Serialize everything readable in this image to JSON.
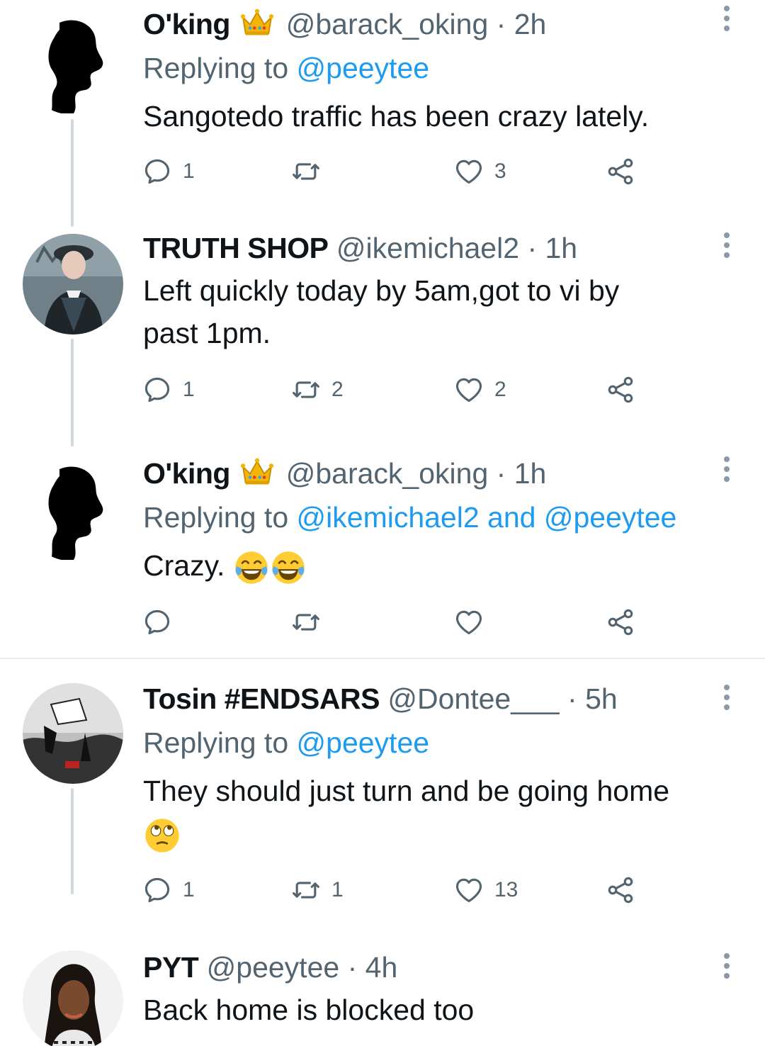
{
  "tweets": [
    {
      "name": "O'king",
      "handle": "@barack_oking",
      "sep": "·",
      "time": "2h",
      "replying_prefix": "Replying to",
      "replying_to": "@peeytee",
      "text": "Sangotedo traffic has been crazy lately.",
      "replies": "1",
      "retweets": "",
      "likes": "3"
    },
    {
      "name": "TRUTH SHOP",
      "handle": "@ikemichael2",
      "sep": "·",
      "time": "1h",
      "text_line1": "Left quickly today by 5am,got to vi by",
      "text_line2": "past 1pm.",
      "replies": "1",
      "retweets": "2",
      "likes": "2"
    },
    {
      "name": "O'king",
      "handle": "@barack_oking",
      "sep": "·",
      "time": "1h",
      "replying_prefix": "Replying to",
      "replying_to": "@ikemichael2 and @peeytee",
      "text": "Crazy.",
      "emoji": "face-with-tears-of-joy x2",
      "replies": "",
      "retweets": "",
      "likes": ""
    },
    {
      "name": "Tosin #ENDSARS",
      "handle": "@Dontee___",
      "sep": "·",
      "time": "5h",
      "replying_prefix": "Replying to",
      "replying_to": "@peeytee",
      "text": "They should just turn and be going home",
      "emoji": "face-with-rolling-eyes",
      "replies": "1",
      "retweets": "1",
      "likes": "13"
    },
    {
      "name": "PYT",
      "handle": "@peeytee",
      "sep": "·",
      "time": "4h",
      "text": "Back home is blocked too"
    }
  ],
  "colors": {
    "text": "#0f1419",
    "secondary": "#536471",
    "link": "#1d9bf0",
    "thread_line": "#cfd9de"
  },
  "icons": [
    "reply-icon",
    "retweet-icon",
    "like-icon",
    "share-icon",
    "more-icon",
    "crown-emoji"
  ]
}
